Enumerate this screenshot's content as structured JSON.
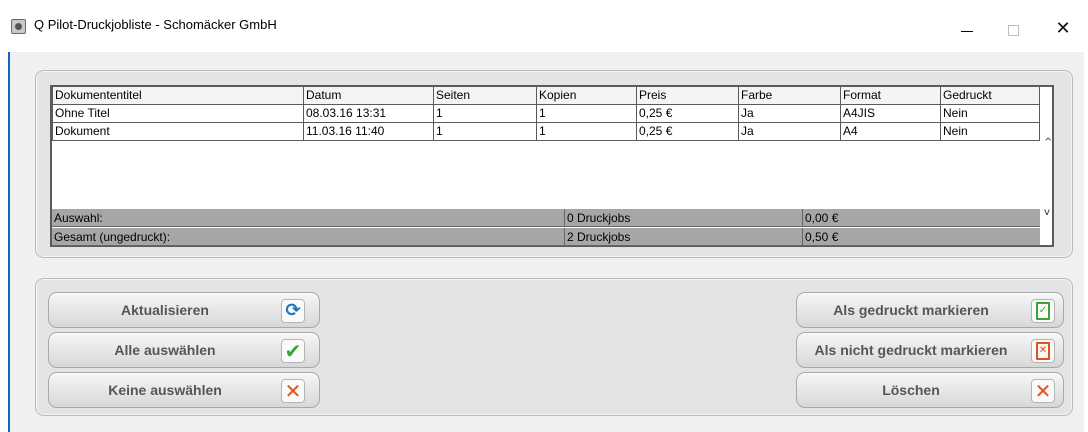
{
  "window": {
    "title": "Q Pilot-Druckjobliste - Schomäcker GmbH",
    "controls": {
      "minimize": "—",
      "maximize": "☐",
      "close": "✕"
    }
  },
  "table": {
    "columns": [
      "Dokumententitel",
      "Datum",
      "Seiten",
      "Kopien",
      "Preis",
      "Farbe",
      "Format",
      "Gedruckt"
    ],
    "rows": [
      [
        "Ohne Titel",
        "08.03.16 13:31",
        "1",
        "1",
        "0,25 €",
        "Ja",
        "A4JIS",
        "Nein"
      ],
      [
        "Dokument",
        "11.03.16 11:40",
        "1",
        "1",
        "0,25 €",
        "Ja",
        "A4",
        "Nein"
      ]
    ],
    "summary": {
      "selection": {
        "label": "Auswahl:",
        "jobs": "0 Druckjobs",
        "amount": "0,00 €"
      },
      "total": {
        "label": "Gesamt (ungedruckt):",
        "jobs": "2 Druckjobs",
        "amount": "0,50 €"
      }
    },
    "scroll": {
      "up": "^",
      "down": "v"
    }
  },
  "buttons": {
    "refresh": {
      "label": "Aktualisieren",
      "icon": "refresh-icon"
    },
    "select_all": {
      "label": "Alle auswählen",
      "icon": "check-icon"
    },
    "select_none": {
      "label": "Keine auswählen",
      "icon": "x-icon"
    },
    "mark_printed": {
      "label": "Als gedruckt markieren",
      "icon": "document-check-icon"
    },
    "mark_unprinted": {
      "label": "Als nicht gedruckt markieren",
      "icon": "document-x-icon"
    },
    "delete": {
      "label": "Löschen",
      "icon": "x-icon"
    }
  },
  "colors": {
    "accent_blue": "#1e73be",
    "check_green": "#2ea83a",
    "cross_orange": "#e0531a",
    "summary_gray": "#a6a6a6"
  }
}
